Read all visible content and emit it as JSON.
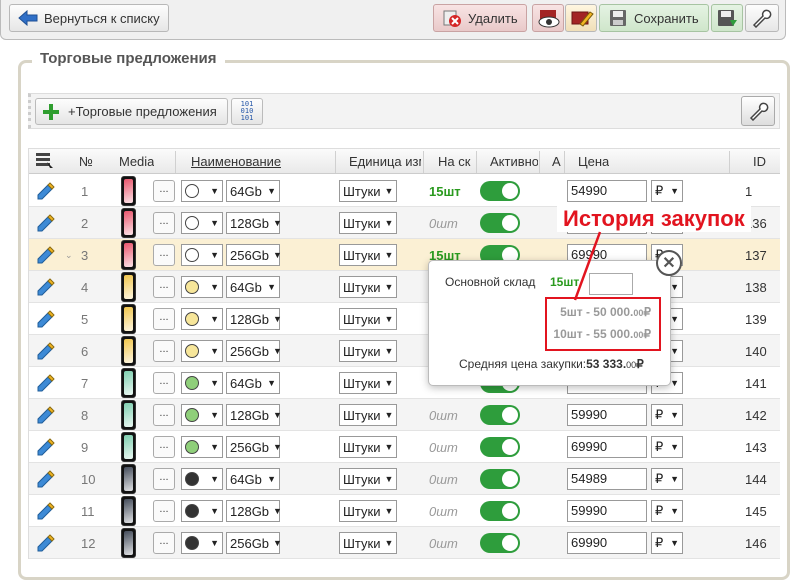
{
  "toolbar": {
    "back_label": "Вернуться к списку",
    "delete_label": "Удалить",
    "save_label": "Сохранить"
  },
  "section": {
    "title": "Торговые предложения",
    "add_label": "+Торговые предложения",
    "binary_glyph": "101\n010\n101"
  },
  "table": {
    "headers": {
      "num": "№",
      "media": "Media",
      "name": "Наименование",
      "unit": "Единица изм",
      "stock": "На ск",
      "active": "Активно",
      "a": "А",
      "price": "Цена",
      "id": "ID"
    },
    "rows": [
      {
        "n": "1",
        "color": "#ffffff",
        "mem": "64Gb",
        "unit": "Штуки",
        "stock": "15шт",
        "stock_zero": false,
        "price": "54990",
        "cur": "₽",
        "id": "1",
        "phone": "#e8556c"
      },
      {
        "n": "2",
        "color": "#ffffff",
        "mem": "128Gb",
        "unit": "Штуки",
        "stock": "0шт",
        "stock_zero": true,
        "price": "",
        "cur": "₽",
        "id": "136",
        "phone": "#e8556c"
      },
      {
        "n": "3",
        "color": "#ffffff",
        "mem": "256Gb",
        "unit": "Штуки",
        "stock": "15шт",
        "stock_zero": false,
        "price": "69990",
        "cur": "₽",
        "id": "137",
        "phone": "#e8556c"
      },
      {
        "n": "4",
        "color": "#f7e69a",
        "mem": "64Gb",
        "unit": "Штуки",
        "stock": "",
        "stock_zero": true,
        "price": "",
        "cur": "₽",
        "id": "138",
        "phone": "#f1c64c"
      },
      {
        "n": "5",
        "color": "#f7e69a",
        "mem": "128Gb",
        "unit": "Штуки",
        "stock": "",
        "stock_zero": true,
        "price": "",
        "cur": "₽",
        "id": "139",
        "phone": "#f1c64c"
      },
      {
        "n": "6",
        "color": "#f7e69a",
        "mem": "256Gb",
        "unit": "Штуки",
        "stock": "",
        "stock_zero": true,
        "price": "",
        "cur": "₽",
        "id": "140",
        "phone": "#f1c64c"
      },
      {
        "n": "7",
        "color": "#8fcf7a",
        "mem": "64Gb",
        "unit": "Штуки",
        "stock": "",
        "stock_zero": true,
        "price": "",
        "cur": "₽",
        "id": "141",
        "phone": "#7fcfb0"
      },
      {
        "n": "8",
        "color": "#8fcf7a",
        "mem": "128Gb",
        "unit": "Штуки",
        "stock": "0шт",
        "stock_zero": true,
        "price": "59990",
        "cur": "₽",
        "id": "142",
        "phone": "#7fcfb0"
      },
      {
        "n": "9",
        "color": "#8fcf7a",
        "mem": "256Gb",
        "unit": "Штуки",
        "stock": "0шт",
        "stock_zero": true,
        "price": "69990",
        "cur": "₽",
        "id": "143",
        "phone": "#7fcfb0"
      },
      {
        "n": "10",
        "color": "#333333",
        "mem": "64Gb",
        "unit": "Штуки",
        "stock": "0шт",
        "stock_zero": true,
        "price": "54989",
        "cur": "₽",
        "id": "144",
        "phone": "#444c5a"
      },
      {
        "n": "11",
        "color": "#333333",
        "mem": "128Gb",
        "unit": "Штуки",
        "stock": "0шт",
        "stock_zero": true,
        "price": "59990",
        "cur": "₽",
        "id": "145",
        "phone": "#444c5a"
      },
      {
        "n": "12",
        "color": "#333333",
        "mem": "256Gb",
        "unit": "Штуки",
        "stock": "0шт",
        "stock_zero": true,
        "price": "69990",
        "cur": "₽",
        "id": "146",
        "phone": "#444c5a"
      }
    ]
  },
  "popover": {
    "warehouse_label": "Основной склад",
    "warehouse_qty": "15шт",
    "history": [
      {
        "text": "5шт - 50 000.",
        "cents": "00",
        "cur": "₽"
      },
      {
        "text": "10шт - 55 000.",
        "cents": "00",
        "cur": "₽"
      }
    ],
    "avg_label": "Средняя цена закупки:",
    "avg_value": "53 333.",
    "avg_cents": "00",
    "avg_cur": "₽"
  },
  "callout": "История закупок",
  "colors": {
    "accent_red": "#e2141f",
    "toggle_green": "#2e9d3c",
    "stock_green": "#2a9a1e"
  }
}
